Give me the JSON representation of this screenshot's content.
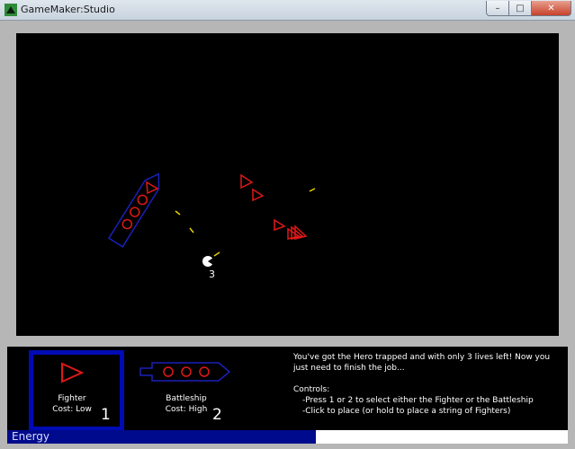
{
  "window": {
    "title": "GameMaker:Studio",
    "buttons": {
      "minimize": "–",
      "maximize": "□",
      "close": "✕"
    }
  },
  "game": {
    "hero_lives": "3"
  },
  "hud": {
    "units": [
      {
        "name": "Fighter",
        "cost": "Cost: Low",
        "key": "1",
        "selected": true
      },
      {
        "name": "Battleship",
        "cost": "Cost: High",
        "key": "2",
        "selected": false
      }
    ],
    "message": "You've got the Hero trapped and with only 3 lives left! Now you just need to finish the job...",
    "controls_title": "Controls:",
    "controls": [
      "-Press 1 or 2 to select either the Fighter or the Battleship",
      "-Click to place (or hold to place a string of Fighters)"
    ]
  },
  "energy": {
    "label": "Energy",
    "level": 0.55
  },
  "colors": {
    "enemy": "#e01818",
    "ally": "#1a20b8",
    "bullet": "#e8d000",
    "hud_select": "#000bb4",
    "energy_fill": "#000a8c"
  }
}
